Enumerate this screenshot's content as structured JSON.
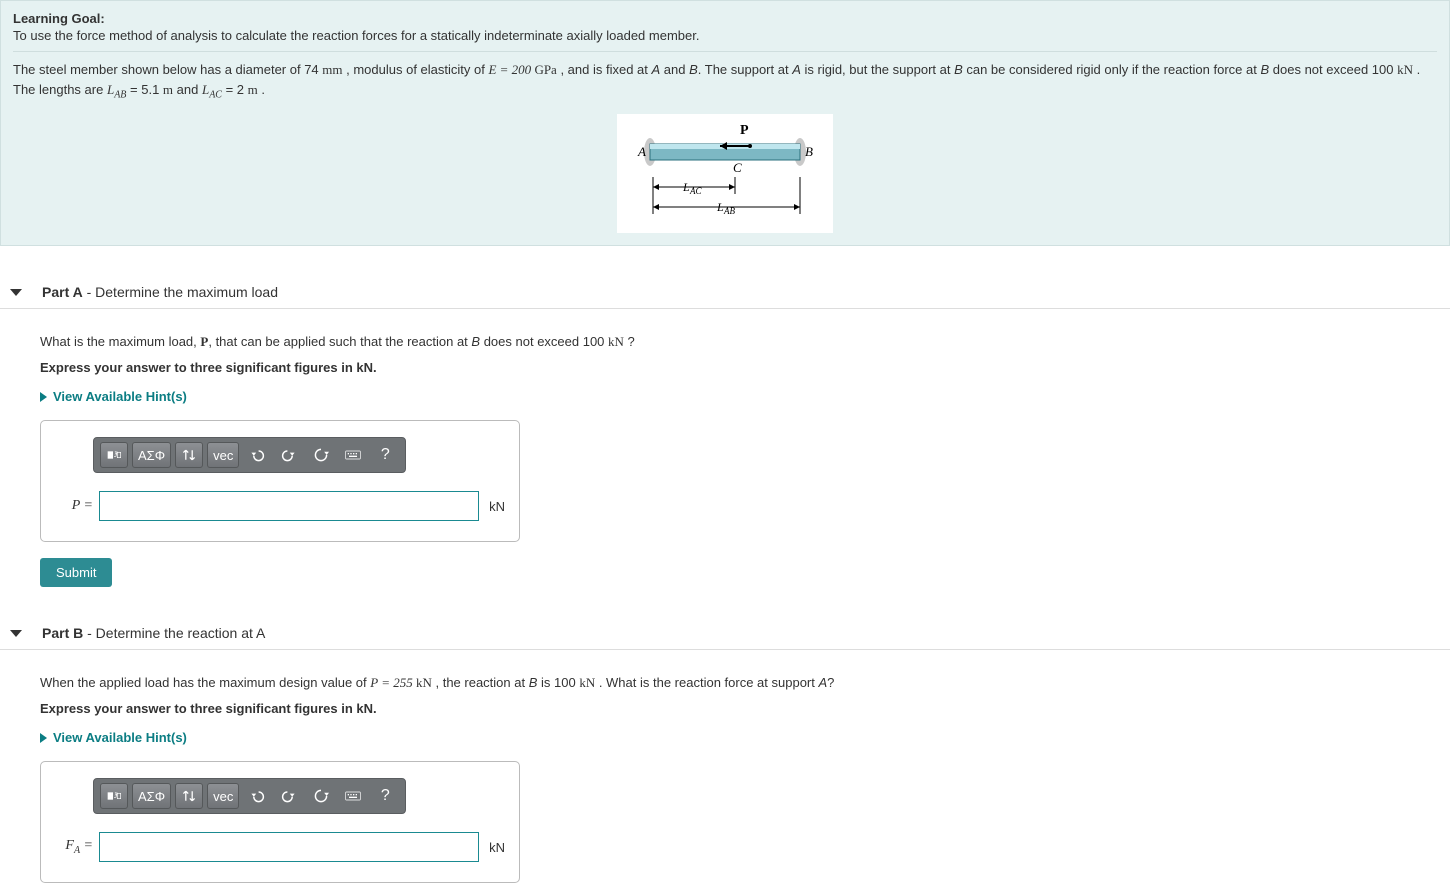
{
  "intro": {
    "lg_title": "Learning Goal:",
    "lg_text": "To use the force method of analysis to calculate the reaction forces for a statically indeterminate axially loaded member.",
    "desc_1a": "The steel member shown below has a diameter of 74 ",
    "unit_mm": "mm",
    "desc_1b": " , modulus of elasticity of ",
    "E_expr": "E = 200 ",
    "unit_gpa": "GPa",
    "desc_1c": " , and is fixed at ",
    "desc_1d": " and ",
    "desc_1e": ". The support at ",
    "desc_1f": " is rigid, but the support at ",
    "desc_1g": " can be considered rigid only if the reaction force at ",
    "desc_1h": " does not exceed 100 ",
    "unit_kn": "kN",
    "desc_2a": "The lengths are ",
    "LAB": "L",
    "LAB_sub": "AB",
    "LAB_val": " = 5.1 ",
    "unit_m": "m",
    "and": " and ",
    "LAC": "L",
    "LAC_sub": "AC",
    "LAC_val": " = 2 ",
    "A": "A",
    "B": "B",
    "period": " .",
    "diagram": {
      "P": "P",
      "A": "A",
      "B": "B",
      "C": "C",
      "LAC": "L",
      "LAC_sub": "AC",
      "LAB": "L",
      "LAB_sub": "AB"
    }
  },
  "partA": {
    "label": "Part A",
    "title": " - Determine the maximum load",
    "q1": "What is the maximum load, ",
    "Pbold": "P",
    "q2": ", that can be applied such that the reaction at ",
    "B": "B",
    "q3": " does not exceed 100 ",
    "kN": "kN",
    "q4": " ?",
    "instr": "Express your answer to three significant figures in kN.",
    "hints": "View Available Hint(s)",
    "var": "P =",
    "unit": "kN",
    "submit": "Submit"
  },
  "partB": {
    "label": "Part B",
    "title": " - Determine the reaction at A",
    "q1": "When the applied load has the maximum design value of ",
    "P_eq": "P = 255 ",
    "kN": "kN",
    "q2": " , the reaction at ",
    "B": "B",
    "q3": " is 100 ",
    "q4": " . What is the reaction force at support ",
    "A": "A",
    "q5": "?",
    "instr": "Express your answer to three significant figures in kN.",
    "hints": "View Available Hint(s)",
    "var": "F",
    "var_sub": "A",
    "var_eq": " =",
    "unit": "kN"
  },
  "toolbar": {
    "greek": "ΑΣΦ",
    "vec": "vec",
    "help": "?"
  }
}
